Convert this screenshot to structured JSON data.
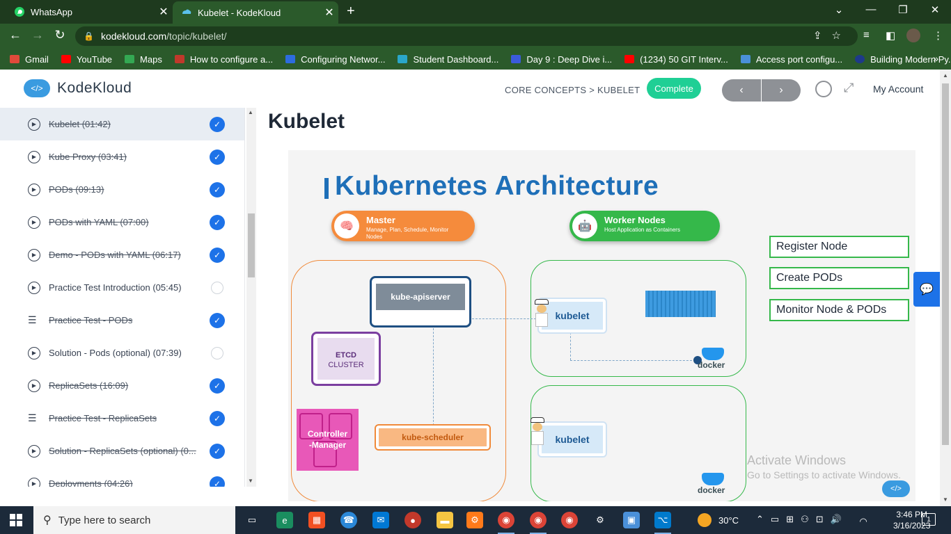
{
  "browser": {
    "tabs": [
      {
        "label": "WhatsApp",
        "icon": "whatsapp-icon"
      },
      {
        "label": "Kubelet - KodeKloud",
        "icon": "kodekloud-icon"
      }
    ],
    "url_host": "kodekloud.com",
    "url_path": "/topic/kubelet/",
    "bookmarks": [
      {
        "label": "Gmail",
        "color": "#e04a3a"
      },
      {
        "label": "YouTube",
        "color": "#ff0000"
      },
      {
        "label": "Maps",
        "color": "#34a853"
      },
      {
        "label": "How to configure a...",
        "color": "#c0392b"
      },
      {
        "label": "Configuring Networ...",
        "color": "#2d6cdf"
      },
      {
        "label": "Student Dashboard...",
        "color": "#2aa7c9"
      },
      {
        "label": "Day 9 : Deep Dive i...",
        "color": "#3b5bdb"
      },
      {
        "label": "(1234) 50 GIT Interv...",
        "color": "#ff0000"
      },
      {
        "label": "Access port configu...",
        "color": "#4a90d9"
      },
      {
        "label": "Building Modern Py...",
        "color": "#1e3a8a"
      }
    ]
  },
  "header": {
    "logo_text": "KodeKloud",
    "breadcrumb": "CORE CONCEPTS > KUBELET",
    "complete_label": "Complete",
    "prev_label": "‹",
    "next_label": "›",
    "account_label": "My Account"
  },
  "sidebar": {
    "items": [
      {
        "title": "Kubelet (01:42)",
        "type": "video",
        "done": true,
        "active": true
      },
      {
        "title": "Kube Proxy (03:41)",
        "type": "video",
        "done": true
      },
      {
        "title": "PODs (09:13)",
        "type": "video",
        "done": true
      },
      {
        "title": "PODs with YAML (07:00)",
        "type": "video",
        "done": true
      },
      {
        "title": "Demo - PODs with YAML (06:17)",
        "type": "video",
        "done": true
      },
      {
        "title": "Practice Test Introduction (05:45)",
        "type": "video",
        "done": false
      },
      {
        "title": "Practice Test - PODs",
        "type": "quiz",
        "done": true
      },
      {
        "title": "Solution - Pods (optional) (07:39)",
        "type": "video",
        "done": false
      },
      {
        "title": "ReplicaSets (16:09)",
        "type": "video",
        "done": true
      },
      {
        "title": "Practice Test - ReplicaSets",
        "type": "quiz",
        "done": true
      },
      {
        "title": "Solution - ReplicaSets (optional) (0...",
        "type": "video",
        "done": true
      },
      {
        "title": "Deployments (04:26)",
        "type": "video",
        "done": true
      }
    ]
  },
  "main": {
    "title": "Kubelet",
    "slide": {
      "heading": "Kubernetes Architecture",
      "master_title": "Master",
      "master_sub": "Manage, Plan, Schedule, Monitor Nodes",
      "worker_title": "Worker Nodes",
      "worker_sub": "Host Application as Containers",
      "apiserver": "kube-apiserver",
      "etcd_line1": "ETCD",
      "etcd_line2": "CLUSTER",
      "controller_line1": "Controller",
      "controller_line2": "-Manager",
      "scheduler": "kube-scheduler",
      "kubelet1": "kubelet",
      "kubelet2": "kubelet",
      "docker1": "docker",
      "docker2": "docker",
      "roles": [
        "Register Node",
        "Create PODs",
        "Monitor Node & PODs"
      ]
    }
  },
  "watermark": {
    "line1": "Activate Windows",
    "line2": "Go to Settings to activate Windows."
  },
  "taskbar": {
    "search_placeholder": "Type here to search",
    "temperature": "30°C",
    "time": "3:46 PM",
    "date": "3/16/2023",
    "notification_count": "1"
  }
}
